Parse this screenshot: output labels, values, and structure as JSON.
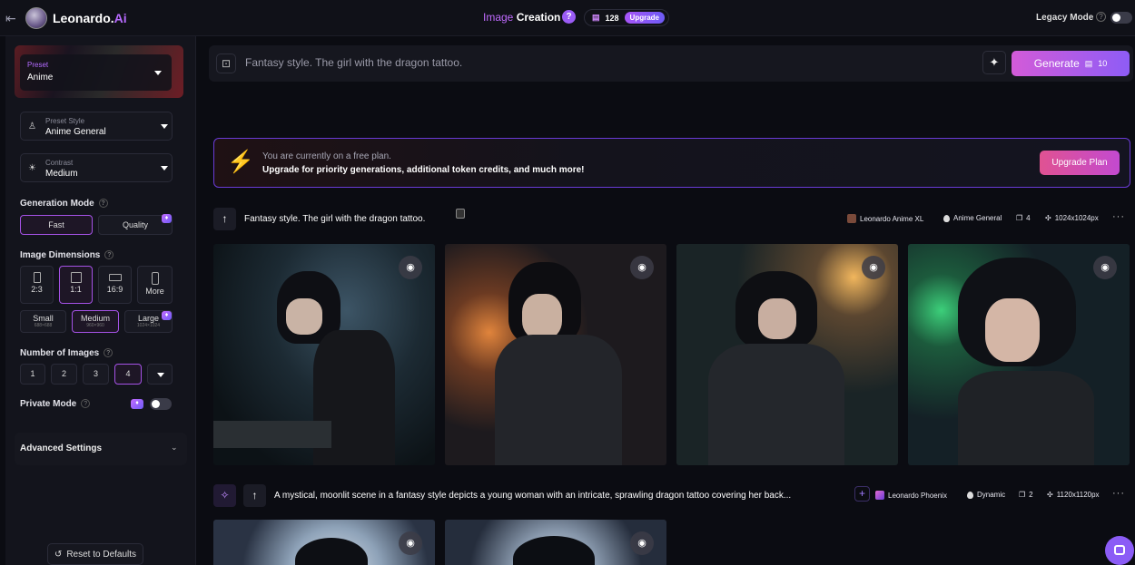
{
  "app": {
    "brand_main": "Leonardo.",
    "brand_ai": "Ai",
    "title_a": "Image",
    "title_b": "Creation",
    "help": "?",
    "tokens": "128",
    "upgrade": "Upgrade",
    "legacy_mode": "Legacy Mode"
  },
  "sidebar": {
    "preset_label": "Preset",
    "preset_value": "Anime",
    "preset_style_label": "Preset Style",
    "preset_style_value": "Anime General",
    "contrast_label": "Contrast",
    "contrast_value": "Medium",
    "generation_mode": "Generation Mode",
    "mode_fast": "Fast",
    "mode_quality": "Quality",
    "image_dimensions": "Image Dimensions",
    "ratios": [
      "2:3",
      "1:1",
      "16:9",
      "More"
    ],
    "sizes": [
      {
        "label": "Small",
        "sub": "688×688"
      },
      {
        "label": "Medium",
        "sub": "960×960"
      },
      {
        "label": "Large",
        "sub": "1024×1024"
      }
    ],
    "number_of_images": "Number of Images",
    "counts": [
      "1",
      "2",
      "3",
      "4"
    ],
    "private_mode": "Private Mode",
    "advanced_settings": "Advanced Settings",
    "reset": "Reset to Defaults"
  },
  "prompt": {
    "text": "Fantasy style. The girl with the dragon tattoo.",
    "generate": "Generate",
    "generate_cost": "10"
  },
  "banner": {
    "line1": "You are currently on a free plan.",
    "line2": "Upgrade for priority generations, additional token credits, and much more!",
    "button": "Upgrade Plan"
  },
  "generations": [
    {
      "prompt": "Fantasy style. The girl with the dragon tattoo.",
      "model": "Leonardo Anime XL",
      "style": "Anime General",
      "count": "4",
      "size": "1024x1024px"
    },
    {
      "prompt": "A mystical, moonlit scene in a fantasy style depicts a young woman with an intricate, sprawling dragon tattoo covering her back...",
      "model": "Leonardo Phoenix",
      "style": "Dynamic",
      "count": "2",
      "size": "1120x1120px"
    }
  ],
  "colors": {
    "accent": "#a855f7",
    "generate_start": "#d35bd8",
    "generate_end": "#8e5cf6",
    "upgrade_plan": "#e05292"
  }
}
